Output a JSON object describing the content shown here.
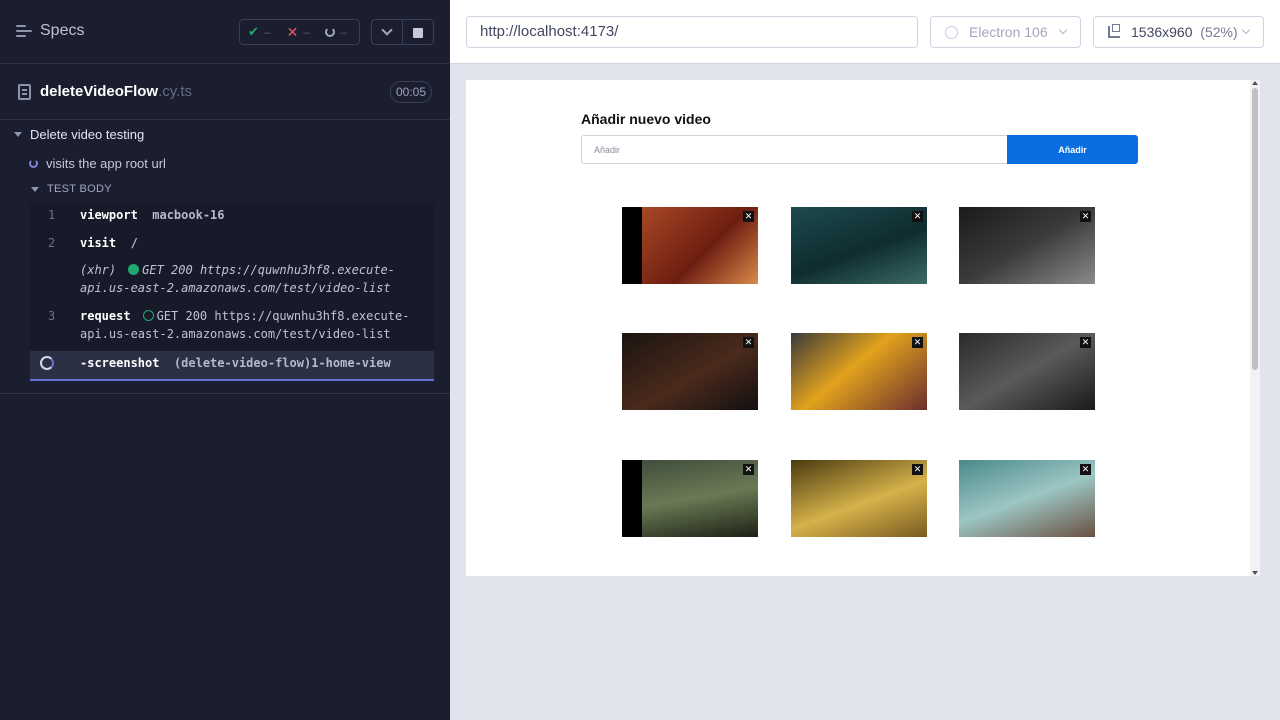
{
  "reporter": {
    "specs_label": "Specs",
    "stats": {
      "passed": "–",
      "failed": "–",
      "pending": "–"
    },
    "spec": {
      "name": "deleteVideoFlow",
      "ext": ".cy.ts",
      "duration": "00:05"
    },
    "suite": {
      "title": "Delete video testing"
    },
    "test": {
      "title": "visits the app root url"
    },
    "body_label": "TEST BODY",
    "commands": [
      {
        "num": "1",
        "name": "viewport",
        "message": "macbook-16"
      },
      {
        "num": "2",
        "name": "visit",
        "message": "/"
      },
      {
        "num": "",
        "name": "(xhr)",
        "status": "GET 200",
        "url_line1": "https://quwnhu3hf8.execute-",
        "url_line2": "api.us-east-2.amazonaws.com/test/video-list"
      },
      {
        "num": "3",
        "name": "request",
        "status": "GET 200",
        "url_line1": "https://quwnhu3hf8.execute-",
        "url_line2": "api.us-east-2.amazonaws.com/test/video-list"
      },
      {
        "num": "",
        "name": "-screenshot",
        "message": "(delete-video-flow)1-home-view"
      }
    ]
  },
  "preview": {
    "url": "http://localhost:4173/",
    "browser": "Electron 106",
    "viewport": "1536x960",
    "zoom": "(52%)"
  },
  "app": {
    "heading": "Añadir nuevo video",
    "input_placeholder": "Añadir",
    "add_button": "Añadir",
    "close_glyph": "✕",
    "thumbnail_count": 9
  },
  "colors": {
    "reporter_bg": "#1b1e2e",
    "accent_blue": "#0a6ee0",
    "pass_green": "#1fa971",
    "fail_red": "#e45770",
    "running_indigo": "#6a6fd4"
  }
}
